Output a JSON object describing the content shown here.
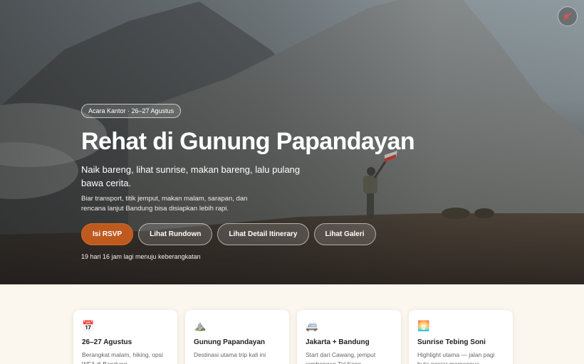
{
  "hero": {
    "badge": "Acara Kantor · 26–27 Agustus",
    "title": "Rehat di Gunung Papandayan",
    "subtitle": "Naik bareng, lihat sunrise, makan bareng, lalu pulang bawa cerita.",
    "description": "Biar transport, titik jemput, makan malam, sarapan, dan rencana lanjut Bandung bisa disiapkan lebih rapi.",
    "buttons": {
      "rsvp": "Isi RSVP",
      "rundown": "Lihat Rundown",
      "itinerary": "Lihat Detail Itinerary",
      "gallery": "Lihat Galeri"
    },
    "countdown": "19 hari 16 jam lagi menuju keberangkatan",
    "sound_icon": "speaker-muted-icon"
  },
  "cards": [
    {
      "icon": "calendar-icon",
      "emoji": "📅",
      "title": "26–27 Agustus",
      "text": "Berangkat malam, hiking, opsi WFA di Bandung"
    },
    {
      "icon": "mountain-icon",
      "emoji": "⛰️",
      "title": "Gunung Papandayan",
      "text": "Destinasi utama trip kali ini"
    },
    {
      "icon": "van-icon",
      "emoji": "🚐",
      "title": "Jakarta + Bandung",
      "text": "Start dari Cawang, jemput rombongan Tol Kopo"
    },
    {
      "icon": "sunrise-icon",
      "emoji": "🌅",
      "title": "Sunrise Tebing Soni",
      "text": "Highlight utama — jalan pagi buta ngejar momennya"
    }
  ],
  "colors": {
    "accent": "#bf5a1e",
    "background": "#fbf6ee"
  }
}
